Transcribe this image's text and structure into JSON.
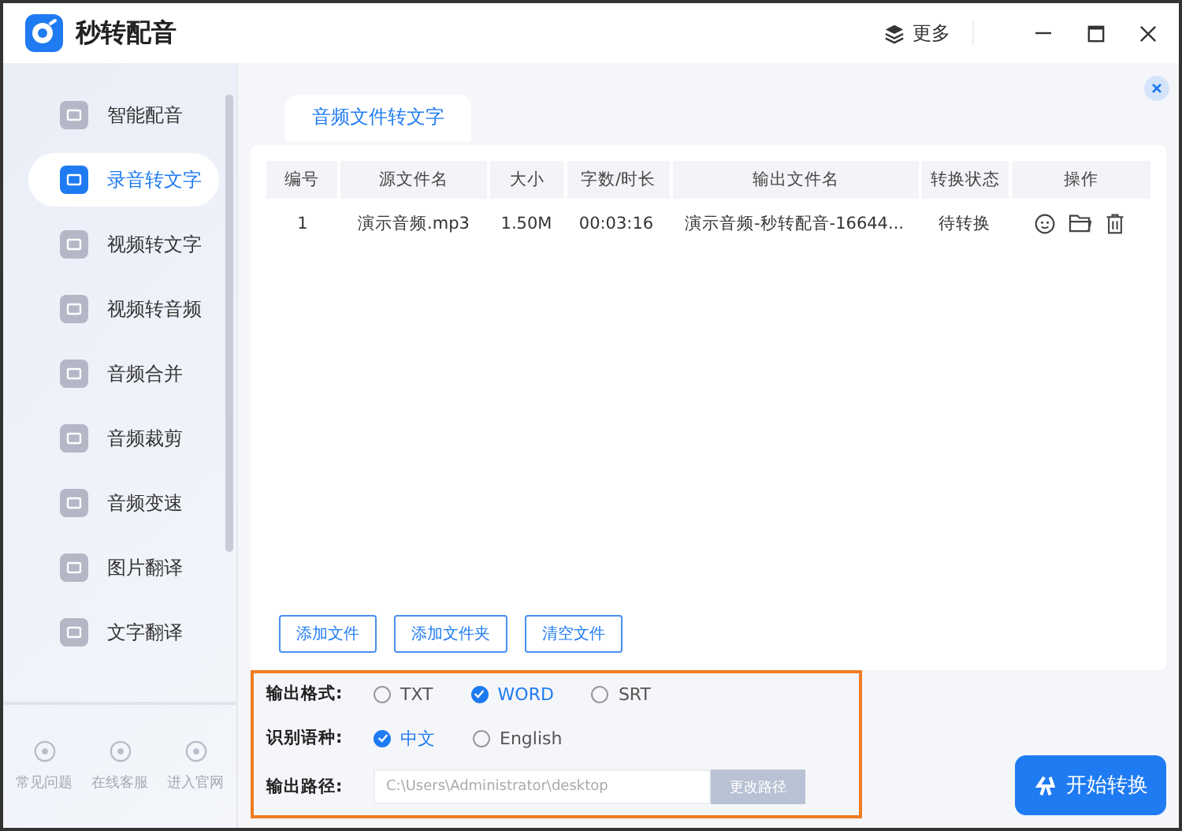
{
  "window": {
    "title": "秒转配音",
    "more": "更多"
  },
  "sidebar": {
    "items": [
      {
        "label": "智能配音",
        "selected": false
      },
      {
        "label": "录音转文字",
        "selected": true
      },
      {
        "label": "视频转文字",
        "selected": false
      },
      {
        "label": "视频转音频",
        "selected": false
      },
      {
        "label": "音频合并",
        "selected": false
      },
      {
        "label": "音频裁剪",
        "selected": false
      },
      {
        "label": "音频变速",
        "selected": false
      },
      {
        "label": "图片翻译",
        "selected": false
      },
      {
        "label": "文字翻译",
        "selected": false
      }
    ],
    "footer": [
      "常见问题",
      "在线客服",
      "进入官网"
    ]
  },
  "tabs": [
    {
      "label": "音频文件转文字",
      "selected": true
    }
  ],
  "table": {
    "columns": [
      "编号",
      "源文件名",
      "大小",
      "字数/时长",
      "输出文件名",
      "转换状态",
      "操作"
    ],
    "rows": [
      {
        "cells": [
          "1",
          "演示音频.mp3",
          "1.50M",
          "00:03:16",
          "演示音频-秒转配音-16644...",
          "待转换"
        ]
      }
    ]
  },
  "file_buttons": [
    "添加文件",
    "添加文件夹",
    "清空文件"
  ],
  "options": {
    "format": {
      "label": "输出格式:",
      "choices": [
        {
          "label": "TXT",
          "selected": false
        },
        {
          "label": "WORD",
          "selected": true
        },
        {
          "label": "SRT",
          "selected": false
        }
      ]
    },
    "language": {
      "label": "识别语种:",
      "choices": [
        {
          "label": "中文",
          "selected": true
        },
        {
          "label": "English",
          "selected": false
        }
      ]
    },
    "path": {
      "label": "输出路径:",
      "placeholder": "C:\\Users\\Administrator\\desktop",
      "button": "更改路径"
    }
  },
  "start_button": "开始转换"
}
